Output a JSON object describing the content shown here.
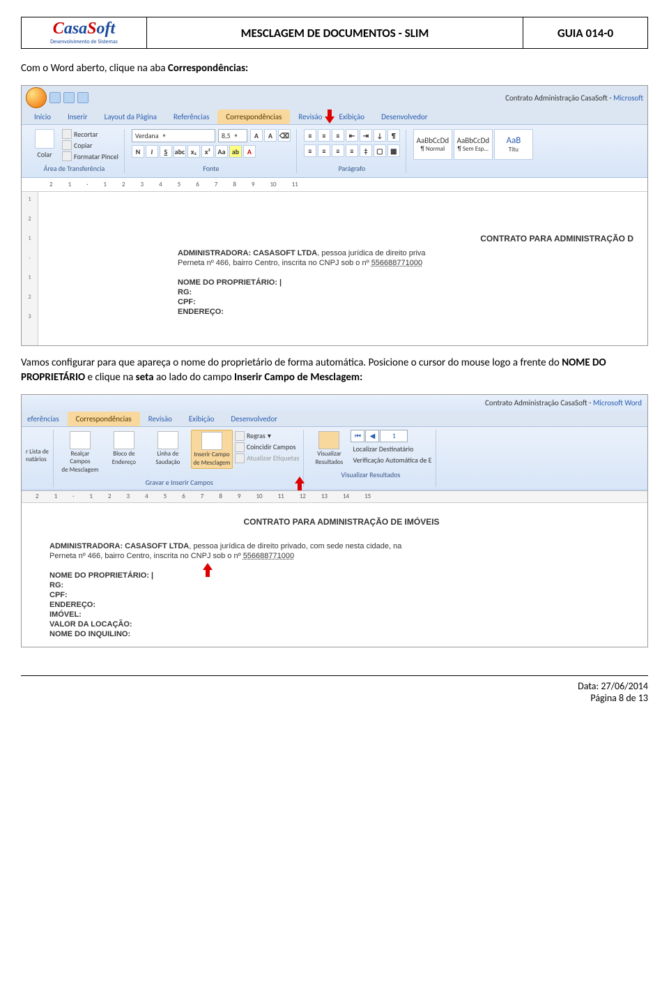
{
  "header": {
    "logo_main": "CasaSoft",
    "logo_sub": "Desenvolvimento de Sistemas",
    "title": "MESCLAGEM DE DOCUMENTOS - SLIM",
    "guide": "GUIA 014-0"
  },
  "intro1_a": "Com o Word aberto, clique na aba ",
  "intro1_b": "Correspondências:",
  "shot1": {
    "window_title_a": "Contrato Administração CasaSoft - ",
    "window_title_b": "Microsoft",
    "tabs": [
      "Início",
      "Inserir",
      "Layout da Página",
      "Referências",
      "Correspondências",
      "Revisão",
      "Exibição",
      "Desenvolvedor"
    ],
    "clipboard": {
      "cut": "Recortar",
      "copy": "Copiar",
      "paste": "Colar",
      "painter": "Formatar Pincel",
      "label": "Área de Transferência"
    },
    "font": {
      "name": "Verdana",
      "size": "8,5",
      "label": "Fonte"
    },
    "para_label": "Parágrafo",
    "styles": [
      {
        "prev": "AaBbCcDd",
        "name": "¶ Normal"
      },
      {
        "prev": "AaBbCcDd",
        "name": "¶ Sem Esp..."
      },
      {
        "prev": "AaB",
        "name": "Títu"
      }
    ],
    "ruler": [
      "2",
      "1",
      "1",
      "2",
      "3",
      "4",
      "5",
      "6",
      "7",
      "8",
      "9",
      "10",
      "11"
    ],
    "vruler": [
      "1",
      "2",
      "1",
      "1",
      "2",
      "3"
    ],
    "doc_title": "CONTRATO PARA ADMINISTRAÇÃO D",
    "admin_label": "ADMINISTRADORA: CASASOFT LTDA",
    "admin_text": ", pessoa jurídica de direito priva",
    "admin_addr": "Perneta nº 466, bairro Centro, inscrita no CNPJ sob o nº ",
    "cnpj": "556688771000",
    "fields": [
      "NOME DO PROPRIETÁRIO: |",
      "RG:",
      "CPF:",
      "ENDEREÇO:"
    ]
  },
  "para2_a": "Vamos configurar para que apareça o nome do proprietário de forma automática. Posicione o cursor do mouse logo a frente do ",
  "para2_b": "NOME DO PROPRIETÁRIO",
  "para2_c": " e clique na ",
  "para2_d": "seta",
  "para2_e": " ao lado do campo ",
  "para2_f": "Inserir Campo de Mesclagem:",
  "shot2": {
    "window_title_a": "Contrato Administração CasaSoft - ",
    "window_title_b": "Microsoft Word",
    "tabs_partial": [
      "eferências",
      "Correspondências",
      "Revisão",
      "Exibição",
      "Desenvolvedor"
    ],
    "left_group": {
      "a": "r Lista de",
      "b": "natários"
    },
    "buttons": [
      {
        "t1": "Realçar Campos",
        "t2": "de Mesclagem"
      },
      {
        "t1": "Bloco de",
        "t2": "Endereço"
      },
      {
        "t1": "Linha de",
        "t2": "Saudação"
      },
      {
        "t1": "Inserir Campo",
        "t2": "de Mesclagem",
        "hl": true
      }
    ],
    "group1_label": "Gravar e Inserir Campos",
    "rules": "Regras",
    "match": "Coincidir Campos",
    "update": "Atualizar Etiquetas",
    "preview": {
      "t1": "Visualizar",
      "t2": "Resultados"
    },
    "nav_num": "1",
    "find": "Localizar Destinatário",
    "verify": "Verificação Automática de E",
    "group2_label": "Visualizar Resultados",
    "ruler": [
      "2",
      "1",
      "1",
      "2",
      "3",
      "4",
      "5",
      "6",
      "7",
      "8",
      "9",
      "10",
      "11",
      "12",
      "13",
      "14",
      "15",
      "1"
    ],
    "doc_title": "CONTRATO PARA ADMINISTRAÇÃO DE IMÓVEIS",
    "admin_label": "ADMINISTRADORA: CASASOFT LTDA",
    "admin_text": ", pessoa jurídica de direito privado, com sede nesta cidade, na",
    "admin_addr": "Perneta nº 466, bairro Centro, inscrita no CNPJ sob o nº ",
    "cnpj": "556688771000",
    "fields": [
      "NOME DO PROPRIETÁRIO: |",
      "RG:",
      "CPF:",
      "ENDEREÇO:",
      "IMÓVEL:",
      "VALOR DA LOCAÇÃO:",
      "NOME DO INQUILINO:"
    ]
  },
  "footer": {
    "date": "Data: 27/06/2014",
    "page": "Página 8 de 13"
  }
}
